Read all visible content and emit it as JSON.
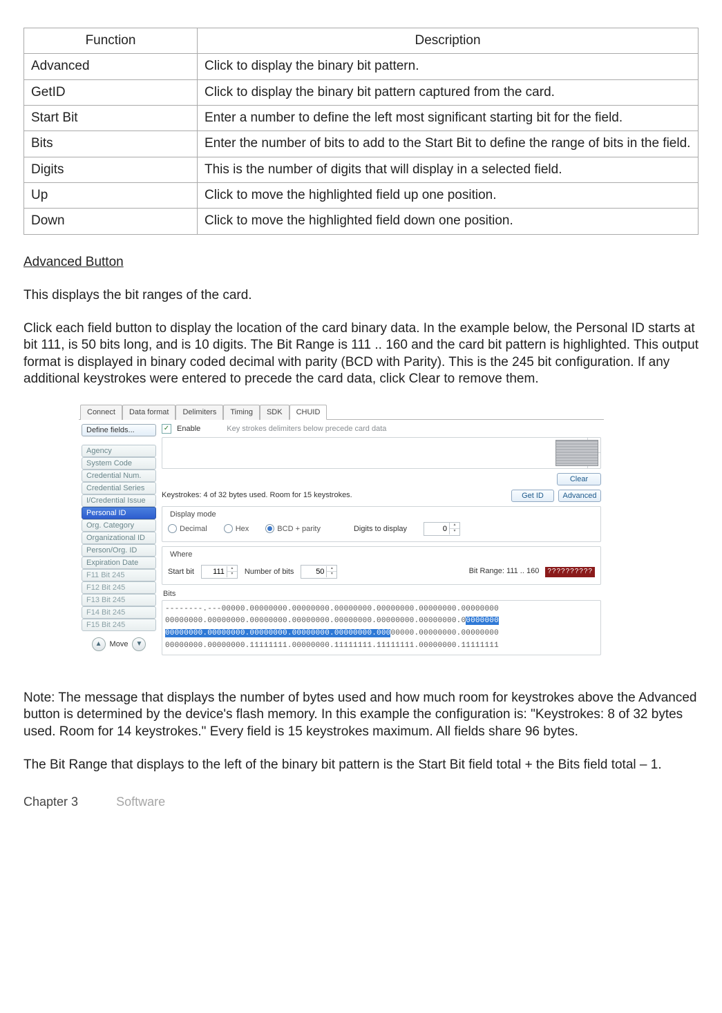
{
  "table": {
    "head": {
      "c1": "Function",
      "c2": "Description"
    },
    "rows": [
      {
        "fn": "Advanced",
        "desc": "Click to display the binary bit pattern."
      },
      {
        "fn": "GetID",
        "desc": "Click to display the binary bit pattern captured from the card."
      },
      {
        "fn": "Start Bit",
        "desc": "Enter a number to define the left most significant starting bit for the field."
      },
      {
        "fn": "Bits",
        "desc": "Enter the number of bits to add to the Start Bit to define the range of bits in the field."
      },
      {
        "fn": "Digits",
        "desc": "This is the number of digits that will display in a selected field."
      },
      {
        "fn": "Up",
        "desc": "Click to move the highlighted field up one position."
      },
      {
        "fn": "Down",
        "desc": "Click to move the highlighted field down one position."
      }
    ]
  },
  "headings": {
    "advanced_button": "Advanced Button"
  },
  "paragraphs": {
    "p1": "This displays the bit ranges of the card.",
    "p2": "Click each field button to display the location of the card binary data. In the example below, the Personal ID starts at bit 111, is 50 bits long, and is 10 digits. The Bit Range is 111 .. 160 and the card bit pattern is highlighted. This output format is displayed in binary coded decimal with parity (BCD with Parity). This is the 245 bit configuration. If any additional keystrokes were entered to precede the card data, click Clear to remove them.",
    "note": "Note: The message that displays the number of bytes used and how much room for keystrokes above the Advanced button is determined by the device's flash memory. In this example the configuration is: \"Keystrokes: 8 of 32 bytes used. Room for 14 keystrokes.\" Every field is 15 keystrokes maximum. All fields share 96 bytes.",
    "bitrange_note": "The Bit Range that displays to the left of the binary bit pattern is the Start Bit field total + the Bits field total – 1."
  },
  "footer": {
    "chapter": "Chapter 3",
    "section": "Software"
  },
  "app": {
    "tabs": [
      "Connect",
      "Data format",
      "Delimiters",
      "Timing",
      "SDK",
      "CHUID"
    ],
    "active_tab": 5,
    "side": {
      "define": "Define fields...",
      "items": [
        "Agency",
        "System Code",
        "Credential Num.",
        "Credential Series",
        "I/Credential Issue",
        "Personal ID",
        "Org. Category",
        "Organizational ID",
        "Person/Org. ID",
        "Expiration Date",
        "F11 Bit 245",
        "F12 Bit 245",
        "F13 Bit 245",
        "F14 Bit 245",
        "F15 Bit 245"
      ],
      "active_index": 5,
      "move": "Move"
    },
    "enable_label": "Enable",
    "hint": "Key strokes delimiters below precede card data",
    "clear": "Clear",
    "keystrokes_msg": "Keystrokes: 4 of 32 bytes used. Room for 15 keystrokes.",
    "getid": "Get ID",
    "advanced": "Advanced",
    "display_mode": {
      "legend": "Display mode",
      "decimal": "Decimal",
      "hex": "Hex",
      "bcd": "BCD + parity",
      "digits_label": "Digits to display",
      "digits_value": "0"
    },
    "where": {
      "legend": "Where",
      "start_label": "Start bit",
      "start_value": "111",
      "num_label": "Number of bits",
      "num_value": "50",
      "range": "Bit Range: 111 .. 160",
      "redblock": "??????????"
    },
    "bits_legend": "Bits",
    "bits_lines": {
      "l1a": "--------.---00000.00000000.00000000.00000000.00000000.00000000.00000000",
      "l2a": "00000000.00000000.00000000.00000000.00000000.00000000.00000000.0",
      "l2b": "0000000",
      "l3a": "00000000.00000000.00000000.00000000.00000000.000",
      "l3b": "00000.00000000.00000000",
      "l4a": "00000000.00000000.11111111.00000000.11111111.11111111.00000000.11111111"
    }
  }
}
